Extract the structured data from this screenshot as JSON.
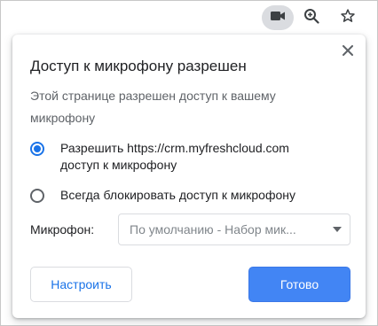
{
  "toolbar": {
    "icons": [
      "camera-icon",
      "zoom-icon",
      "star-icon"
    ],
    "active_bg": "#dadce0"
  },
  "popup": {
    "title": "Доступ к микрофону разрешен",
    "description": "Этой странице разрешен доступ к вашему микрофону",
    "options": [
      {
        "label": "Разрешить https://crm.myfreshcloud.com доступ к микрофону",
        "selected": true
      },
      {
        "label": "Всегда блокировать доступ к микрофону",
        "selected": false
      }
    ],
    "microphone_label": "Микрофон:",
    "microphone_value": "По умолчанию - Набор мик...",
    "configure_label": "Настроить",
    "done_label": "Готово",
    "accent_color": "#1a73e8",
    "done_color": "#4285f4"
  }
}
